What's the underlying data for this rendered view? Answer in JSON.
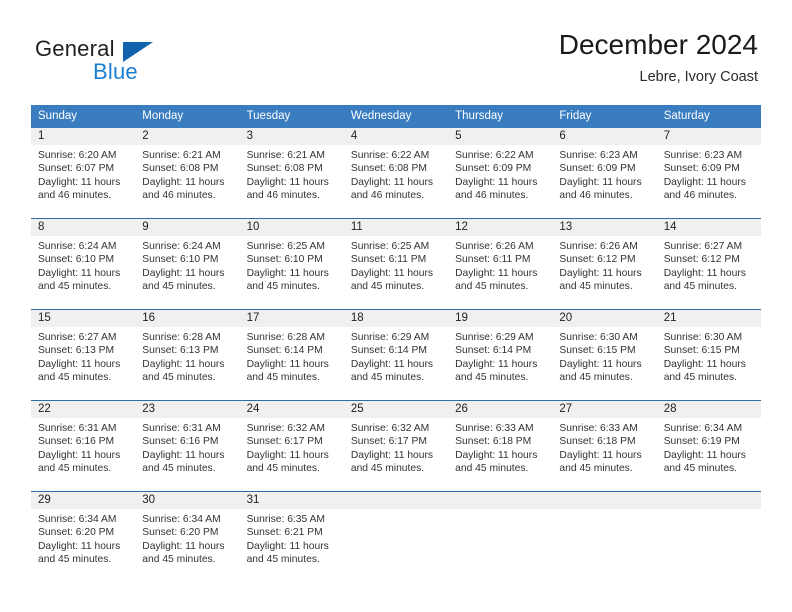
{
  "logo": {
    "word_top": "General",
    "word_bottom": "Blue",
    "triangle_color": "#1062ac",
    "blue_color": "#1b7fd4"
  },
  "header": {
    "title": "December 2024",
    "subtitle": "Lebre, Ivory Coast"
  },
  "theme": {
    "header_bg": "#3a7cc0",
    "header_text": "#ffffff",
    "daynum_bg": "#f0f0f0",
    "row_divider": "#2f6ca8"
  },
  "calendar": {
    "weekdays": [
      "Sunday",
      "Monday",
      "Tuesday",
      "Wednesday",
      "Thursday",
      "Friday",
      "Saturday"
    ],
    "weeks": [
      [
        {
          "day": "1",
          "sunrise": "Sunrise: 6:20 AM",
          "sunset": "Sunset: 6:07 PM",
          "daylight1": "Daylight: 11 hours",
          "daylight2": "and 46 minutes."
        },
        {
          "day": "2",
          "sunrise": "Sunrise: 6:21 AM",
          "sunset": "Sunset: 6:08 PM",
          "daylight1": "Daylight: 11 hours",
          "daylight2": "and 46 minutes."
        },
        {
          "day": "3",
          "sunrise": "Sunrise: 6:21 AM",
          "sunset": "Sunset: 6:08 PM",
          "daylight1": "Daylight: 11 hours",
          "daylight2": "and 46 minutes."
        },
        {
          "day": "4",
          "sunrise": "Sunrise: 6:22 AM",
          "sunset": "Sunset: 6:08 PM",
          "daylight1": "Daylight: 11 hours",
          "daylight2": "and 46 minutes."
        },
        {
          "day": "5",
          "sunrise": "Sunrise: 6:22 AM",
          "sunset": "Sunset: 6:09 PM",
          "daylight1": "Daylight: 11 hours",
          "daylight2": "and 46 minutes."
        },
        {
          "day": "6",
          "sunrise": "Sunrise: 6:23 AM",
          "sunset": "Sunset: 6:09 PM",
          "daylight1": "Daylight: 11 hours",
          "daylight2": "and 46 minutes."
        },
        {
          "day": "7",
          "sunrise": "Sunrise: 6:23 AM",
          "sunset": "Sunset: 6:09 PM",
          "daylight1": "Daylight: 11 hours",
          "daylight2": "and 46 minutes."
        }
      ],
      [
        {
          "day": "8",
          "sunrise": "Sunrise: 6:24 AM",
          "sunset": "Sunset: 6:10 PM",
          "daylight1": "Daylight: 11 hours",
          "daylight2": "and 45 minutes."
        },
        {
          "day": "9",
          "sunrise": "Sunrise: 6:24 AM",
          "sunset": "Sunset: 6:10 PM",
          "daylight1": "Daylight: 11 hours",
          "daylight2": "and 45 minutes."
        },
        {
          "day": "10",
          "sunrise": "Sunrise: 6:25 AM",
          "sunset": "Sunset: 6:10 PM",
          "daylight1": "Daylight: 11 hours",
          "daylight2": "and 45 minutes."
        },
        {
          "day": "11",
          "sunrise": "Sunrise: 6:25 AM",
          "sunset": "Sunset: 6:11 PM",
          "daylight1": "Daylight: 11 hours",
          "daylight2": "and 45 minutes."
        },
        {
          "day": "12",
          "sunrise": "Sunrise: 6:26 AM",
          "sunset": "Sunset: 6:11 PM",
          "daylight1": "Daylight: 11 hours",
          "daylight2": "and 45 minutes."
        },
        {
          "day": "13",
          "sunrise": "Sunrise: 6:26 AM",
          "sunset": "Sunset: 6:12 PM",
          "daylight1": "Daylight: 11 hours",
          "daylight2": "and 45 minutes."
        },
        {
          "day": "14",
          "sunrise": "Sunrise: 6:27 AM",
          "sunset": "Sunset: 6:12 PM",
          "daylight1": "Daylight: 11 hours",
          "daylight2": "and 45 minutes."
        }
      ],
      [
        {
          "day": "15",
          "sunrise": "Sunrise: 6:27 AM",
          "sunset": "Sunset: 6:13 PM",
          "daylight1": "Daylight: 11 hours",
          "daylight2": "and 45 minutes."
        },
        {
          "day": "16",
          "sunrise": "Sunrise: 6:28 AM",
          "sunset": "Sunset: 6:13 PM",
          "daylight1": "Daylight: 11 hours",
          "daylight2": "and 45 minutes."
        },
        {
          "day": "17",
          "sunrise": "Sunrise: 6:28 AM",
          "sunset": "Sunset: 6:14 PM",
          "daylight1": "Daylight: 11 hours",
          "daylight2": "and 45 minutes."
        },
        {
          "day": "18",
          "sunrise": "Sunrise: 6:29 AM",
          "sunset": "Sunset: 6:14 PM",
          "daylight1": "Daylight: 11 hours",
          "daylight2": "and 45 minutes."
        },
        {
          "day": "19",
          "sunrise": "Sunrise: 6:29 AM",
          "sunset": "Sunset: 6:14 PM",
          "daylight1": "Daylight: 11 hours",
          "daylight2": "and 45 minutes."
        },
        {
          "day": "20",
          "sunrise": "Sunrise: 6:30 AM",
          "sunset": "Sunset: 6:15 PM",
          "daylight1": "Daylight: 11 hours",
          "daylight2": "and 45 minutes."
        },
        {
          "day": "21",
          "sunrise": "Sunrise: 6:30 AM",
          "sunset": "Sunset: 6:15 PM",
          "daylight1": "Daylight: 11 hours",
          "daylight2": "and 45 minutes."
        }
      ],
      [
        {
          "day": "22",
          "sunrise": "Sunrise: 6:31 AM",
          "sunset": "Sunset: 6:16 PM",
          "daylight1": "Daylight: 11 hours",
          "daylight2": "and 45 minutes."
        },
        {
          "day": "23",
          "sunrise": "Sunrise: 6:31 AM",
          "sunset": "Sunset: 6:16 PM",
          "daylight1": "Daylight: 11 hours",
          "daylight2": "and 45 minutes."
        },
        {
          "day": "24",
          "sunrise": "Sunrise: 6:32 AM",
          "sunset": "Sunset: 6:17 PM",
          "daylight1": "Daylight: 11 hours",
          "daylight2": "and 45 minutes."
        },
        {
          "day": "25",
          "sunrise": "Sunrise: 6:32 AM",
          "sunset": "Sunset: 6:17 PM",
          "daylight1": "Daylight: 11 hours",
          "daylight2": "and 45 minutes."
        },
        {
          "day": "26",
          "sunrise": "Sunrise: 6:33 AM",
          "sunset": "Sunset: 6:18 PM",
          "daylight1": "Daylight: 11 hours",
          "daylight2": "and 45 minutes."
        },
        {
          "day": "27",
          "sunrise": "Sunrise: 6:33 AM",
          "sunset": "Sunset: 6:18 PM",
          "daylight1": "Daylight: 11 hours",
          "daylight2": "and 45 minutes."
        },
        {
          "day": "28",
          "sunrise": "Sunrise: 6:34 AM",
          "sunset": "Sunset: 6:19 PM",
          "daylight1": "Daylight: 11 hours",
          "daylight2": "and 45 minutes."
        }
      ],
      [
        {
          "day": "29",
          "sunrise": "Sunrise: 6:34 AM",
          "sunset": "Sunset: 6:20 PM",
          "daylight1": "Daylight: 11 hours",
          "daylight2": "and 45 minutes."
        },
        {
          "day": "30",
          "sunrise": "Sunrise: 6:34 AM",
          "sunset": "Sunset: 6:20 PM",
          "daylight1": "Daylight: 11 hours",
          "daylight2": "and 45 minutes."
        },
        {
          "day": "31",
          "sunrise": "Sunrise: 6:35 AM",
          "sunset": "Sunset: 6:21 PM",
          "daylight1": "Daylight: 11 hours",
          "daylight2": "and 45 minutes."
        },
        {
          "day": "",
          "sunrise": "",
          "sunset": "",
          "daylight1": "",
          "daylight2": ""
        },
        {
          "day": "",
          "sunrise": "",
          "sunset": "",
          "daylight1": "",
          "daylight2": ""
        },
        {
          "day": "",
          "sunrise": "",
          "sunset": "",
          "daylight1": "",
          "daylight2": ""
        },
        {
          "day": "",
          "sunrise": "",
          "sunset": "",
          "daylight1": "",
          "daylight2": ""
        }
      ]
    ]
  }
}
